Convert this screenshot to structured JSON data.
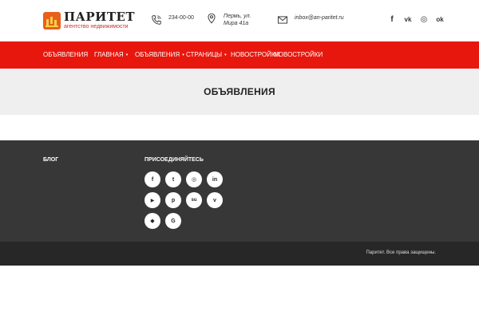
{
  "header": {
    "logo": {
      "title": "ПАРИТЕТ",
      "subtitle": "агентство недвижимости"
    },
    "phone": {
      "icon": "phone-icon",
      "text": "234-00-00"
    },
    "address": {
      "icon": "map-pin-icon",
      "text": "Пермь, ул. Мира 41а"
    },
    "email": {
      "icon": "envelope-icon",
      "text": "inbox@an-paritet.ru"
    },
    "socials": [
      {
        "icon": "facebook-icon",
        "glyph": "f"
      },
      {
        "icon": "vk-icon",
        "glyph": "vk"
      },
      {
        "icon": "instagram-icon",
        "glyph": "◎"
      },
      {
        "icon": "odnoklassniki-icon",
        "glyph": "ok"
      }
    ]
  },
  "nav": {
    "items": [
      {
        "label": "ОБЪЯВЛЕНИЯ",
        "dropdown": false
      },
      {
        "label": "ГЛАВНАЯ",
        "dropdown": true
      },
      {
        "label": "ОБЪЯВЛЕНИЯ",
        "dropdown": true
      },
      {
        "label": "СТРАНИЦЫ",
        "dropdown": true
      },
      {
        "label": "НОВОСТРОЙКИ",
        "dropdown": false
      },
      {
        "label": "НОВОСТРОЙКИ",
        "dropdown": false
      }
    ],
    "caret": "▾"
  },
  "page": {
    "title": "ОБЪЯВЛЕНИЯ"
  },
  "footer": {
    "blog_heading": "БЛОГ",
    "join_heading": "ПРИСОЕДИНЯЙТЕСЬ",
    "socials": [
      {
        "icon": "facebook-icon",
        "glyph": "f"
      },
      {
        "icon": "twitter-icon",
        "glyph": "t"
      },
      {
        "icon": "instagram-icon",
        "glyph": "◎"
      },
      {
        "icon": "linkedin-icon",
        "glyph": "in"
      },
      {
        "icon": "youtube-icon",
        "glyph": "▶"
      },
      {
        "icon": "pinterest-icon",
        "glyph": "p"
      },
      {
        "icon": "stumbleupon-icon",
        "glyph": "su"
      },
      {
        "icon": "vimeo-icon",
        "glyph": "v"
      },
      {
        "icon": "dropbox-icon",
        "glyph": "◆"
      },
      {
        "icon": "google-icon",
        "glyph": "G"
      }
    ],
    "copyright": "Паритет. Все права защищены."
  },
  "colors": {
    "nav_red": "#e8170d",
    "footer_dark": "#373737",
    "bottom_bar": "#272727",
    "title_band": "#efefef",
    "logo_orange": "#e8601c"
  }
}
